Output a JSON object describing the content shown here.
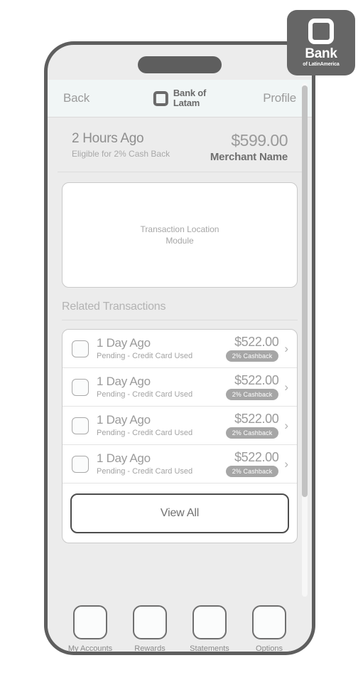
{
  "brand_badge": {
    "name": "Bank",
    "sub": "of LatinAmerica",
    "icon": "rounded-square-logo-icon"
  },
  "header": {
    "back_label": "Back",
    "profile_label": "Profile",
    "logo_line1": "Bank of",
    "logo_line2": "Latam",
    "logo_icon": "square-outline-icon"
  },
  "summary": {
    "time": "2 Hours Ago",
    "eligibility": "Eligible for 2% Cash Back",
    "amount": "$599.00",
    "merchant": "Merchant Name"
  },
  "location_module": {
    "line1": "Transaction Location",
    "line2": "Module"
  },
  "related": {
    "title": "Related Transactions",
    "transactions": [
      {
        "when": "1 Day Ago",
        "status": "Pending - Credit Card Used",
        "amount": "$522.00",
        "badge": "2% Cashback",
        "chevron": "›"
      },
      {
        "when": "1 Day Ago",
        "status": "Pending - Credit Card Used",
        "amount": "$522.00",
        "badge": "2% Cashback",
        "chevron": "›"
      },
      {
        "when": "1 Day Ago",
        "status": "Pending - Credit Card Used",
        "amount": "$522.00",
        "badge": "2% Cashback",
        "chevron": "›"
      },
      {
        "when": "1 Day Ago",
        "status": "Pending - Credit Card Used",
        "amount": "$522.00",
        "badge": "2% Cashback",
        "chevron": "›"
      }
    ],
    "view_all_label": "View All"
  },
  "tabbar": {
    "items": [
      {
        "label": "My Accounts",
        "icon": "accounts-icon"
      },
      {
        "label": "Rewards",
        "icon": "rewards-icon"
      },
      {
        "label": "Statements",
        "icon": "statements-icon"
      },
      {
        "label": "Options",
        "icon": "options-icon"
      }
    ]
  },
  "colors": {
    "bezel": "#5e5e5e",
    "screen_bg": "#ececec",
    "header_bg": "#f1f6f6",
    "badge_bg": "#a6a6a6",
    "text_muted": "#9b9b9b",
    "button_border": "#4d4d4d"
  }
}
